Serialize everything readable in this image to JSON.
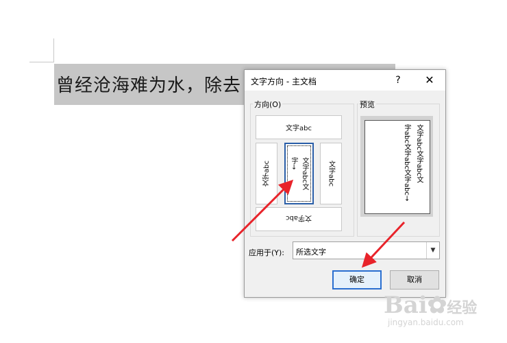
{
  "document": {
    "text": "曾经沧海难为水，除去"
  },
  "dialog": {
    "title": "文字方向 - 主文档",
    "help_icon": "?",
    "close_icon": "✕",
    "direction_group_label": "方向(O)",
    "preview_group_label": "预览",
    "options": [
      {
        "id": "horizontal",
        "label": "文字abc"
      },
      {
        "id": "vertical-rotated-left",
        "label": "文字abc"
      },
      {
        "id": "vertical-stacked",
        "col1": "文字abc文",
        "col2": "字→"
      },
      {
        "id": "vertical-rotated-right",
        "label": "文字abc"
      },
      {
        "id": "horizontal-upside-down",
        "label": "文字abc"
      }
    ],
    "selected_option": "vertical-stacked",
    "preview_lines": [
      "文字abc文字abc文",
      "字abc文字abc文字abc→"
    ],
    "apply_to_label": "应用于(Y):",
    "apply_to_value": "所选文字",
    "ok_label": "确定",
    "cancel_label": "取消"
  },
  "annotations": {
    "arrow_color": "#e8232a"
  },
  "watermark": {
    "brand": "Bai",
    "brand_suffix": "经验",
    "url": "jingyan.baidu.com"
  }
}
